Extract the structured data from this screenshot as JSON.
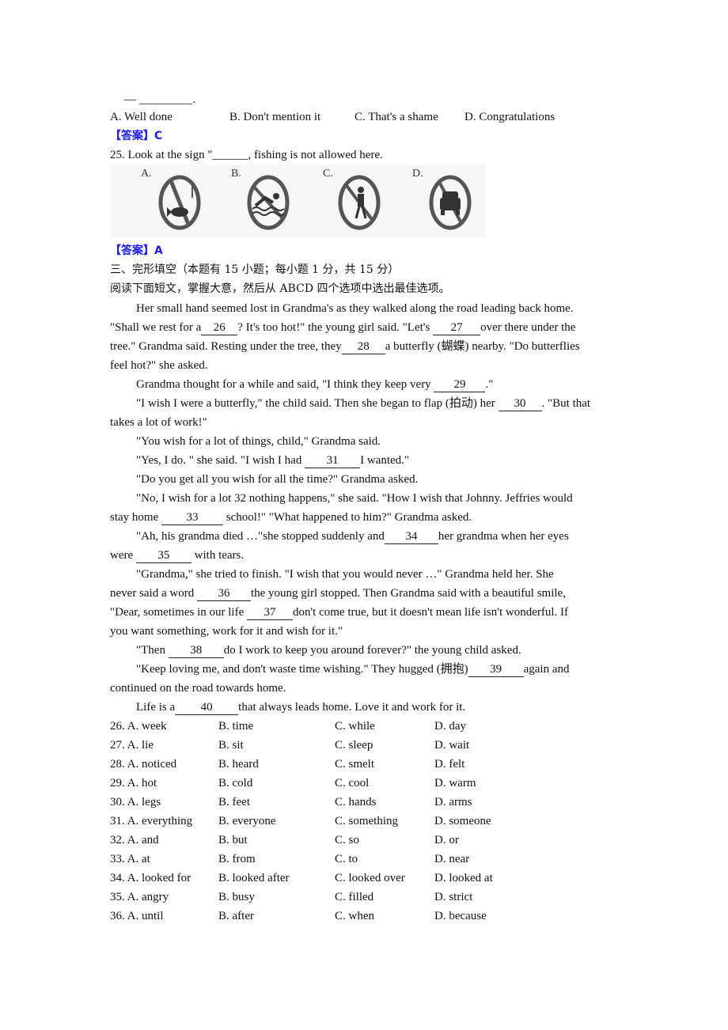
{
  "q24": {
    "dash_line": "— _________.",
    "options": [
      "A. Well done",
      "B. Don't mention it",
      "C. That's a shame",
      "D. Congratulations"
    ],
    "answer_label": "【答案】",
    "answer": "C"
  },
  "q25": {
    "question": "25. Look at the sign \"______, fishing is not allowed here.",
    "signs": [
      {
        "label": "A.",
        "icon": "no-fishing-icon"
      },
      {
        "label": "B.",
        "icon": "no-swimming-icon"
      },
      {
        "label": "C.",
        "icon": "no-pedestrians-icon"
      },
      {
        "label": "D.",
        "icon": "no-vehicles-icon"
      }
    ],
    "answer_label": "【答案】",
    "answer": "A"
  },
  "section3": {
    "heading": "三、完形填空（本题有 15 小题；每小题 1 分，共 15 分）",
    "instruction": "阅读下面短文，掌握大意，然后从 ABCD 四个选项中选出最佳选项。"
  },
  "passage": {
    "p1_l1": "Her small hand seemed lost in Grandma's as they walked along the road leading back home.",
    "p1_l2a": "\"Shall we rest for a",
    "b26": "26",
    "p1_l2b": "? It's too hot!\" the young girl said. \"Let's ",
    "b27": "27",
    "p1_l2c": "over there under the",
    "p1_l3a": "tree.\" Grandma said. Resting under the tree, they",
    "b28": "28",
    "p1_l3b": "a butterfly (蝴蝶) nearby. \"Do butterflies",
    "p1_l4": "feel hot?\" she asked.",
    "p2a": "Grandma thought for a while and said, \"I think they keep very ",
    "b29": "29",
    "p2b": ".\"",
    "p3_l1a": "\"I wish I were a butterfly,\" the child said. Then she began to flap (拍动) her ",
    "b30": "30",
    "p3_l1b": ". \"But that",
    "p3_l2": "takes a lot of work!\"",
    "p4": "\"You wish for a lot of things, child,\" Grandma said.",
    "p5a": "\"Yes, I do. \" she said. \"I wish I had ",
    "b31": "31",
    "p5b": "I wanted.\"",
    "p6": "\"Do you get all you wish for all the time?\" Grandma asked.",
    "p7_l1": "\"No, I wish for a lot 32 nothing happens,\" she said. \"How I wish that Johnny. Jeffries would",
    "p7_l2a": "stay home ",
    "b33": "33",
    "p7_l2b": " school!\" \"What happened to him?\" Grandma asked.",
    "p8_l1a": "\"Ah, his grandma died …\"she stopped suddenly and",
    "b34": "34",
    "p8_l1b": "her grandma when  her eyes",
    "p8_l2a": "were ",
    "b35": "35",
    "p8_l2b": " with tears.",
    "p9_l1": "\"Grandma,\" she tried to finish. \"I wish that you would never …\" Grandma held her. She",
    "p9_l2a": "never said a word ",
    "b36": "36",
    "p9_l2b": "the young girl stopped. Then Grandma said with a beautiful smile,",
    "p9_l3a": "\"Dear, sometimes in our life ",
    "b37": "37",
    "p9_l3b": "don't come true, but it doesn't mean life isn't wonderful. If",
    "p9_l4": "you want something, work for it and wish for it.\"",
    "p10a": "\"Then ",
    "b38": "38",
    "p10b": "do I work to keep you around forever?\" the young child asked.",
    "p11_l1a": "\"Keep loving me, and don't waste time wishing.\" They hugged (拥抱)",
    "b39": "39",
    "p11_l1b": "again and",
    "p11_l2": "continued on the road towards home.",
    "p12a": "Life is a",
    "b40": "40",
    "p12b": "that always leads home. Love it and work for it."
  },
  "options": [
    {
      "num": "26. A. week",
      "b": "B. time",
      "c": "C. while",
      "d": "D. day"
    },
    {
      "num": "27. A. lie",
      "b": "B. sit",
      "c": "C. sleep",
      "d": "D. wait"
    },
    {
      "num": "28. A. noticed",
      "b": "B. heard",
      "c": "C. smelt",
      "d": "D. felt"
    },
    {
      "num": "29. A. hot",
      "b": "B. cold",
      "c": "C. cool",
      "d": "D. warm"
    },
    {
      "num": "30. A. legs",
      "b": "B. feet",
      "c": "C. hands",
      "d": "D. arms"
    },
    {
      "num": "31. A. everything",
      "b": "B. everyone",
      "c": "C. something",
      "d": "D. someone"
    },
    {
      "num": "32. A. and",
      "b": "B. but",
      "c": "C. so",
      "d": "D. or"
    },
    {
      "num": "33. A. at",
      "b": "B. from",
      "c": "C. to",
      "d": "D. near"
    },
    {
      "num": "34. A. looked for",
      "b": "B. looked after",
      "c": "C. looked over",
      "d": "D. looked at"
    },
    {
      "num": "35. A. angry",
      "b": "B. busy",
      "c": "C. filled",
      "d": "D. strict"
    },
    {
      "num": "36. A. until",
      "b": "B. after",
      "c": "C. when",
      "d": "D. because"
    }
  ]
}
